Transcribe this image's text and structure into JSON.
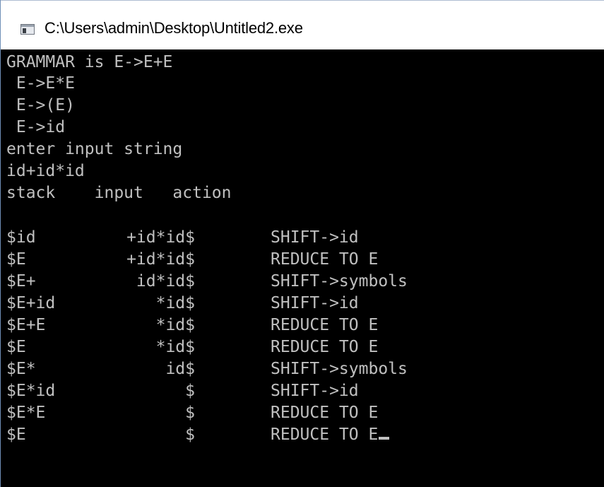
{
  "window": {
    "title": "C:\\Users\\admin\\Desktop\\Untitled2.exe",
    "icon": "console-window-icon"
  },
  "console": {
    "header_lines": [
      "GRAMMAR is E->E+E",
      " E->E*E",
      " E->(E)",
      " E->id",
      "enter input string",
      "id+id*id",
      "stack    input   action"
    ],
    "rows": [
      {
        "stack": "$id",
        "input": "+id*id$",
        "action": "SHIFT->id"
      },
      {
        "stack": "$E",
        "input": "+id*id$",
        "action": "REDUCE TO E"
      },
      {
        "stack": "$E+",
        "input": "id*id$",
        "action": "SHIFT->symbols"
      },
      {
        "stack": "$E+id",
        "input": "*id$",
        "action": "SHIFT->id"
      },
      {
        "stack": "$E+E",
        "input": "*id$",
        "action": "REDUCE TO E"
      },
      {
        "stack": "$E",
        "input": "*id$",
        "action": "REDUCE TO E"
      },
      {
        "stack": "$E*",
        "input": "id$",
        "action": "SHIFT->symbols"
      },
      {
        "stack": "$E*id",
        "input": "$",
        "action": "SHIFT->id"
      },
      {
        "stack": "$E*E",
        "input": "$",
        "action": "REDUCE TO E"
      },
      {
        "stack": "$E",
        "input": "$",
        "action": "REDUCE TO E"
      }
    ],
    "text_color": "#c0c0c0",
    "background_color": "#000000"
  }
}
